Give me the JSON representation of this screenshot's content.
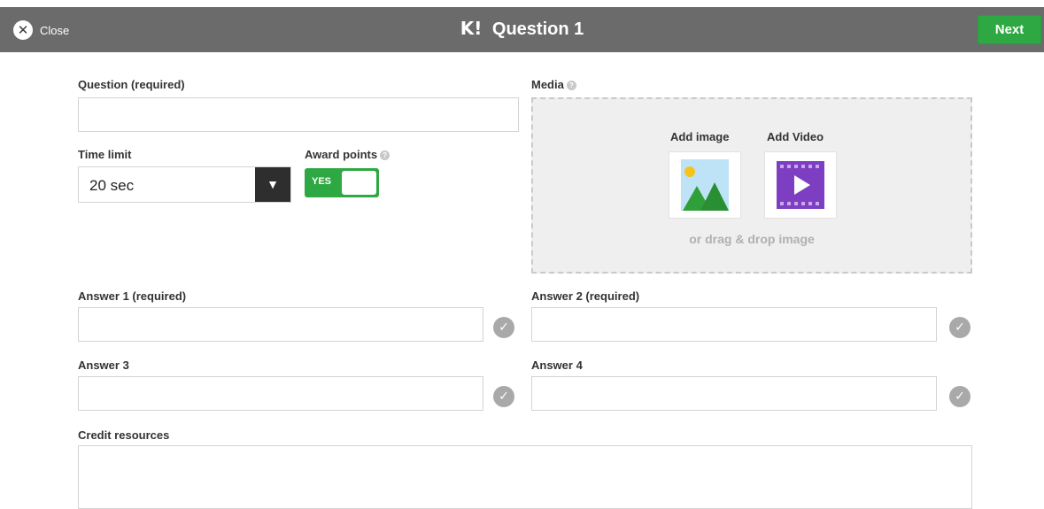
{
  "header": {
    "close_label": "Close",
    "title": "Question 1",
    "logo": "K!",
    "next_label": "Next"
  },
  "question": {
    "label": "Question (required)",
    "value": ""
  },
  "time_limit": {
    "label": "Time limit",
    "selected": "20 sec"
  },
  "award_points": {
    "label": "Award points",
    "toggle_label": "YES",
    "enabled": true
  },
  "media": {
    "label": "Media",
    "add_image_label": "Add image",
    "add_video_label": "Add Video",
    "drag_text": "or drag & drop image"
  },
  "answers": [
    {
      "label": "Answer 1 (required)",
      "value": ""
    },
    {
      "label": "Answer 2 (required)",
      "value": ""
    },
    {
      "label": "Answer 3",
      "value": ""
    },
    {
      "label": "Answer 4",
      "value": ""
    }
  ],
  "credit_resources": {
    "label": "Credit resources",
    "value": ""
  },
  "colors": {
    "topbar": "#6b6b6b",
    "accent_green": "#2ea843",
    "video_purple": "#7d3ec2",
    "image_sky": "#bfe3f6",
    "image_mountain": "#2f9f3a",
    "image_sun": "#f6c21c"
  },
  "icons": {
    "close": "close-icon",
    "help": "help-icon",
    "dropdown": "triangle-down-icon",
    "image": "image-icon",
    "video": "video-icon",
    "check": "checkmark-icon"
  }
}
